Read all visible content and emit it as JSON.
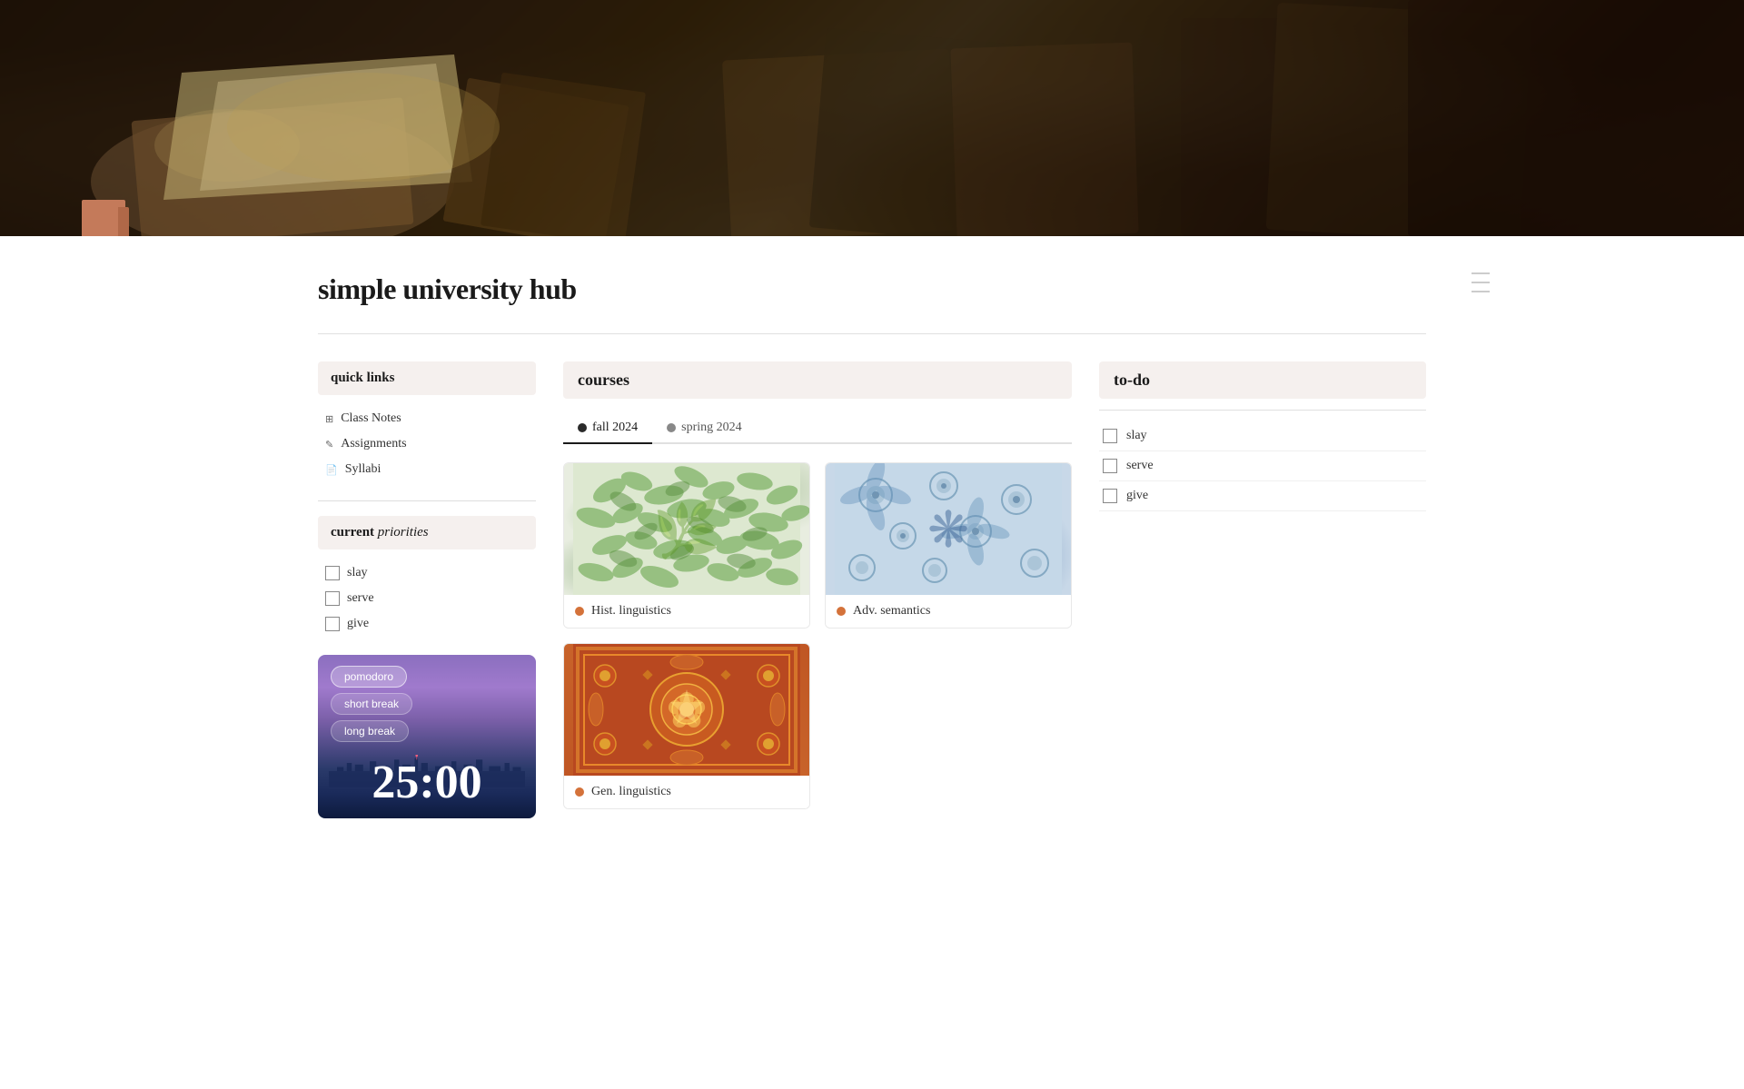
{
  "header": {
    "image_alt": "Classical painting of books and manuscripts"
  },
  "page": {
    "title": "simple university hub"
  },
  "sidebar": {
    "quick_links_heading": "quick links",
    "links": [
      {
        "label": "Class Notes",
        "icon": "⊞"
      },
      {
        "label": "Assignments",
        "icon": "✎"
      },
      {
        "label": "Syllabi",
        "icon": "📄"
      }
    ],
    "priorities_heading_regular": "current",
    "priorities_heading_italic": "priorities",
    "priorities": [
      {
        "label": "slay",
        "checked": false
      },
      {
        "label": "serve",
        "checked": false
      },
      {
        "label": "give",
        "checked": false
      }
    ]
  },
  "pomodoro": {
    "buttons": [
      {
        "label": "pomodoro",
        "active": true
      },
      {
        "label": "short break",
        "active": false
      },
      {
        "label": "long break",
        "active": false
      }
    ],
    "timer": "25:00"
  },
  "courses": {
    "heading": "courses",
    "tabs": [
      {
        "label": "fall 2024",
        "active": true,
        "dot": "dark"
      },
      {
        "label": "spring 2024",
        "active": false,
        "dot": "gray"
      }
    ],
    "cards": [
      {
        "title": "Hist. linguistics",
        "thumb_style": "botanical-green",
        "dot": "orange"
      },
      {
        "title": "Adv. semantics",
        "thumb_style": "blue-floral",
        "dot": "orange"
      },
      {
        "title": "Gen. linguistics",
        "thumb_style": "red-carpet",
        "dot": "orange"
      }
    ]
  },
  "todo": {
    "heading": "to-do",
    "items": [
      {
        "label": "slay",
        "checked": false
      },
      {
        "label": "serve",
        "checked": false
      },
      {
        "label": "give",
        "checked": false
      }
    ]
  },
  "sidebar_lines": [
    "",
    "",
    ""
  ]
}
